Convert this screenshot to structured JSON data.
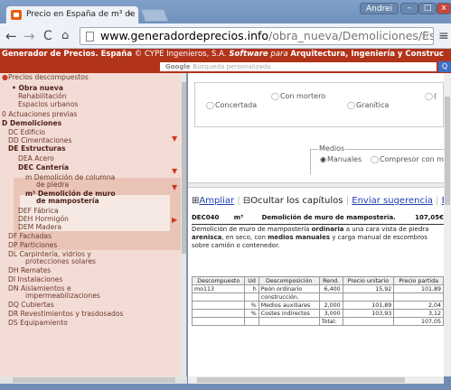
{
  "browser": {
    "tab_title": "Precio en España de m³ de",
    "tab_close": "×",
    "user": "Andrei",
    "win_min": "–",
    "win_max": "□",
    "win_close": "x",
    "url_host": "www.generadordeprecios.info",
    "url_path": "/obra_nueva/Demoliciones/Estructuras/",
    "back": "←",
    "forward": "→",
    "reload": "C",
    "home": "⌂",
    "star": "☆",
    "menu": "≡"
  },
  "site_header": {
    "brand": "Generador de Precios. España",
    "company": " © CYPE Ingenieros, S.A.",
    "tagline_a": "  Software",
    "tagline_b": " para ",
    "tagline_c": "Arquitectura, Ingeniería y Construc"
  },
  "google_search": {
    "logo": "Google",
    "placeholder": "Búsqueda personalizada",
    "go": "Q"
  },
  "tree": [
    {
      "label": "Precios descompuestos",
      "style": "normal"
    },
    {
      "label": "• Obra nueva",
      "style": "bold"
    },
    {
      "label": "Rehabilitación",
      "style": "normal"
    },
    {
      "label": "Espacios urbanos",
      "style": "normal"
    },
    {
      "label": "0 Actuaciones previas",
      "style": "normal"
    },
    {
      "label": "D Demoliciones",
      "style": "bold"
    },
    {
      "label": "DC Edificio",
      "style": "normal"
    },
    {
      "label": "DD Cimentaciones",
      "style": "normal"
    },
    {
      "label": "DE Estructuras",
      "style": "bold"
    },
    {
      "label": "DEA Acero",
      "style": "normal"
    },
    {
      "label": "DEC Cantería",
      "style": "bold"
    },
    {
      "label": "m  Demolición de columna",
      "style": "normal"
    },
    {
      "label": "de piedra",
      "style": "normal"
    },
    {
      "label": "m³ Demolición de muro",
      "style": "bold"
    },
    {
      "label": "de mampostería",
      "style": "bold"
    },
    {
      "label": "DEF Fábrica",
      "style": "normal"
    },
    {
      "label": "DEH Hormigón",
      "style": "normal"
    },
    {
      "label": "DEM Madera",
      "style": "normal"
    },
    {
      "label": "DF Fachadas",
      "style": "normal"
    },
    {
      "label": "DP Particiones",
      "style": "normal"
    },
    {
      "label": "DL Carpintería, vidrios y",
      "style": "normal"
    },
    {
      "label": "protecciones solares",
      "style": "normal"
    },
    {
      "label": "DH Remates",
      "style": "normal"
    },
    {
      "label": "DI Instalaciones",
      "style": "normal"
    },
    {
      "label": "DN Aislamientos e",
      "style": "normal"
    },
    {
      "label": "impermeabilizaciones",
      "style": "normal"
    },
    {
      "label": "DQ Cubiertas",
      "style": "normal"
    },
    {
      "label": "DR Revestimientos y trasdosados",
      "style": "normal"
    },
    {
      "label": "DS Equipamiento",
      "style": "normal"
    }
  ],
  "options": {
    "type_options": [
      "Concertada",
      "Con mortero",
      "Granítica",
      "("
    ],
    "medios_label": "Medios",
    "medios_options": [
      "Manuales",
      "Compresor con m"
    ]
  },
  "actions": {
    "ampliar": "Ampliar",
    "ocultar": "Ocultar los capítulos",
    "sugerencia": "Enviar sugerencia",
    "ex": "Ex"
  },
  "item": {
    "code": "DEC040",
    "unit": "m³",
    "title": "Demolición de muro de mampostería.",
    "price": "107,05€",
    "desc_a": "Demolición de muro de mampostería ",
    "desc_b": "ordinaria",
    "desc_c": " a una cara vista de piedra ",
    "desc_d": "arenisca",
    "desc_e": ", en seco, con ",
    "desc_f": "medios manuales",
    "desc_g": " y carga manual de escombros sobre camión o contenedor."
  },
  "table": {
    "headers": [
      "Descompuesto",
      "Ud",
      "Descomposición",
      "Rend.",
      "Precio unitario",
      "Precio partida"
    ],
    "rows": [
      {
        "code": "mo113",
        "ud": "h",
        "desc": "Peón ordinario",
        "rend": "6,400",
        "pu": "15,92",
        "pp": "101,89"
      },
      {
        "code": "",
        "ud": "",
        "desc": "construcción.",
        "rend": "",
        "pu": "",
        "pp": ""
      },
      {
        "code": "",
        "ud": "%",
        "desc": "Medios auxiliares",
        "rend": "2,000",
        "pu": "101,89",
        "pp": "2,04"
      },
      {
        "code": "",
        "ud": "%",
        "desc": "Costes indirectos",
        "rend": "3,000",
        "pu": "103,93",
        "pp": "3,12"
      },
      {
        "code": "",
        "ud": "",
        "desc": "",
        "rend": "Total:",
        "pu": "",
        "pp": "107,05"
      }
    ]
  }
}
